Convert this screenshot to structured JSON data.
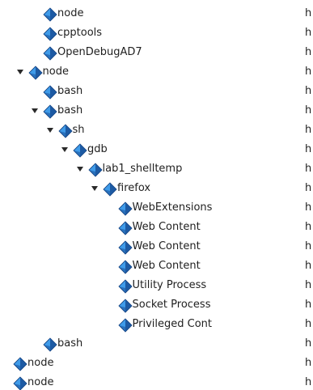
{
  "process_tree": {
    "rows": [
      {
        "name": "node",
        "depth": 2,
        "expanded": null,
        "col2": "h"
      },
      {
        "name": "cpptools",
        "depth": 2,
        "expanded": null,
        "col2": "h"
      },
      {
        "name": "OpenDebugAD7",
        "depth": 2,
        "expanded": null,
        "col2": "h"
      },
      {
        "name": "node",
        "depth": 1,
        "expanded": true,
        "col2": "h"
      },
      {
        "name": "bash",
        "depth": 2,
        "expanded": null,
        "col2": "h"
      },
      {
        "name": "bash",
        "depth": 2,
        "expanded": true,
        "col2": "h"
      },
      {
        "name": "sh",
        "depth": 3,
        "expanded": true,
        "col2": "h"
      },
      {
        "name": "gdb",
        "depth": 4,
        "expanded": true,
        "col2": "h"
      },
      {
        "name": "lab1_shelltemp",
        "depth": 5,
        "expanded": true,
        "col2": "h"
      },
      {
        "name": "firefox",
        "depth": 6,
        "expanded": true,
        "col2": "h"
      },
      {
        "name": "WebExtensions",
        "depth": 7,
        "expanded": null,
        "col2": "h"
      },
      {
        "name": "Web Content",
        "depth": 7,
        "expanded": null,
        "col2": "h"
      },
      {
        "name": "Web Content",
        "depth": 7,
        "expanded": null,
        "col2": "h"
      },
      {
        "name": "Web Content",
        "depth": 7,
        "expanded": null,
        "col2": "h"
      },
      {
        "name": "Utility Process",
        "depth": 7,
        "expanded": null,
        "col2": "h"
      },
      {
        "name": "Socket Process",
        "depth": 7,
        "expanded": null,
        "col2": "h"
      },
      {
        "name": "Privileged Cont",
        "depth": 7,
        "expanded": null,
        "col2": "h"
      },
      {
        "name": "bash",
        "depth": 2,
        "expanded": null,
        "col2": "h"
      },
      {
        "name": "node",
        "depth": 0,
        "expanded": null,
        "col2": "h"
      },
      {
        "name": "node",
        "depth": 0,
        "expanded": null,
        "col2": "h"
      }
    ]
  },
  "icons": {
    "process": "process-diamond-icon",
    "expander": "triangle-down-icon"
  },
  "colors": {
    "icon_light": "#3f9be9",
    "icon_dark": "#184f97",
    "icon_edge": "#0d3a78",
    "arrow": "#2a2a2a",
    "text": "#1f1f1f",
    "background": "#ffffff"
  }
}
